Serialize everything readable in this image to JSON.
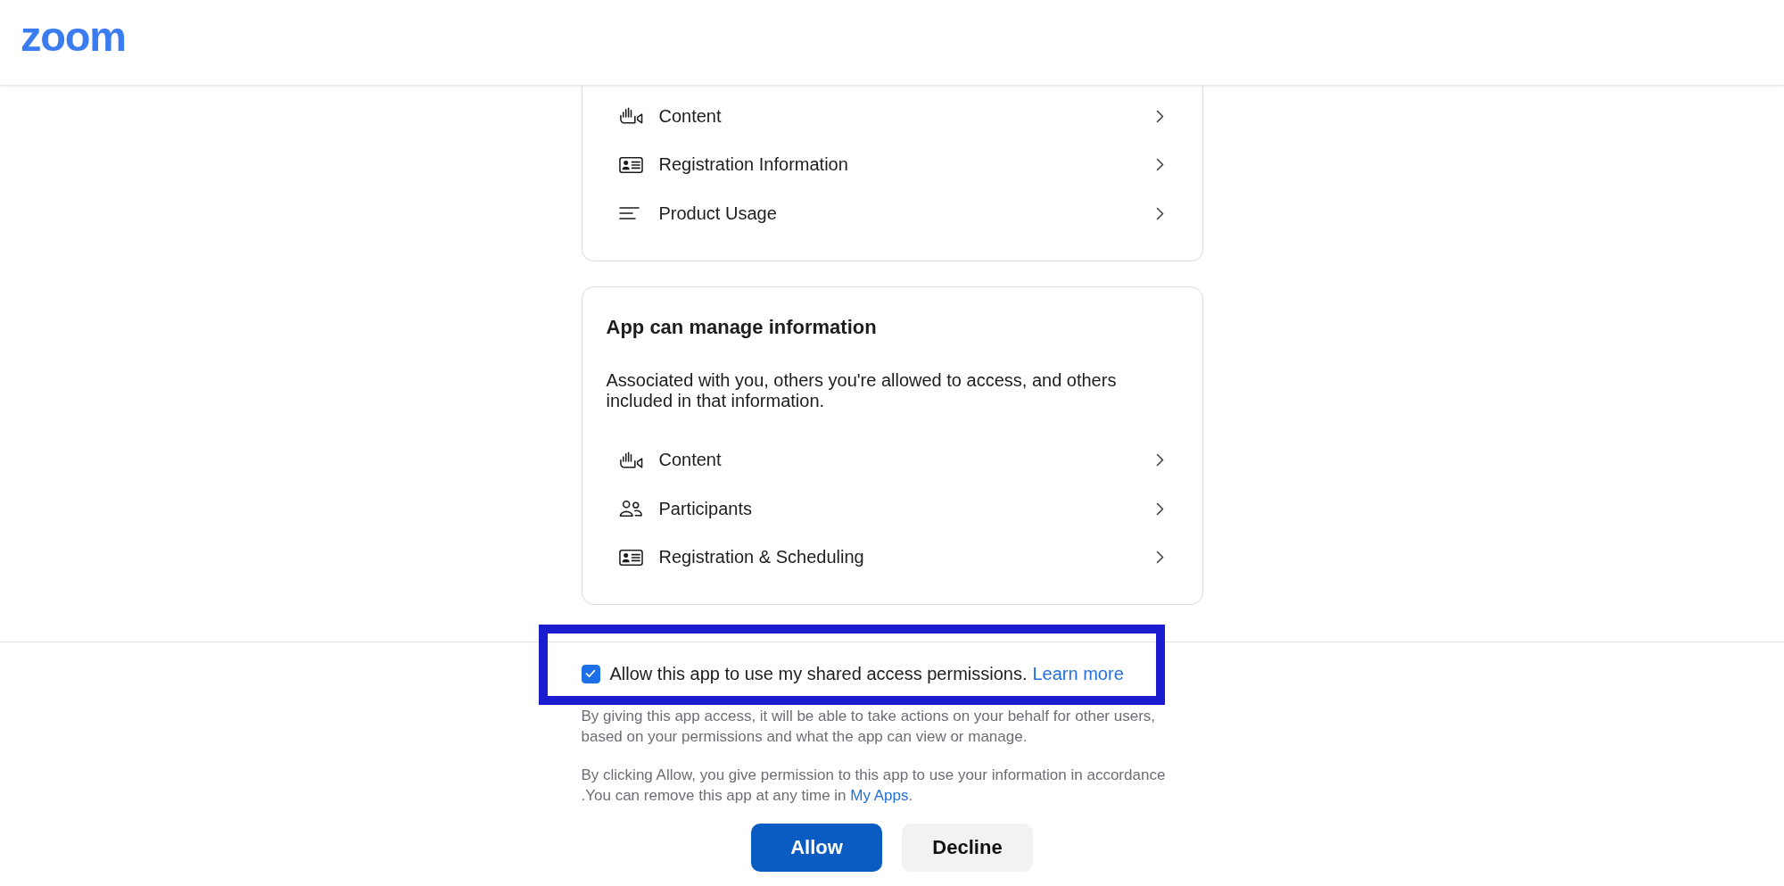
{
  "header": {
    "logo": "zoom"
  },
  "cards": [
    {
      "items": [
        {
          "kind": "content",
          "label": "Content"
        },
        {
          "kind": "registration",
          "label": "Registration Information"
        },
        {
          "kind": "usage",
          "label": "Product Usage"
        }
      ]
    },
    {
      "title": "App can manage information",
      "description": "Associated with you, others you're allowed to access, and others included in that information.",
      "items": [
        {
          "kind": "content",
          "label": "Content"
        },
        {
          "kind": "participants",
          "label": "Participants"
        },
        {
          "kind": "registration",
          "label": "Registration & Scheduling"
        }
      ]
    }
  ],
  "consent": {
    "highlighted": true,
    "checkbox": {
      "checked": true,
      "label": "Allow this app to use my shared access permissions.",
      "link": "Learn more"
    },
    "notes": [
      {
        "text": "By giving this app access, it will be able to take actions on your behalf for other users, based on your permissions and what the app can view or manage."
      },
      {
        "text": "By clicking Allow, you give permission to this app to use your information in accordance .You can remove this app at any time in ",
        "link": "My Apps",
        "after": "."
      }
    ]
  },
  "buttons": [
    {
      "kind": "primary",
      "label": "Allow"
    },
    {
      "kind": "secondary",
      "label": "Decline"
    }
  ]
}
